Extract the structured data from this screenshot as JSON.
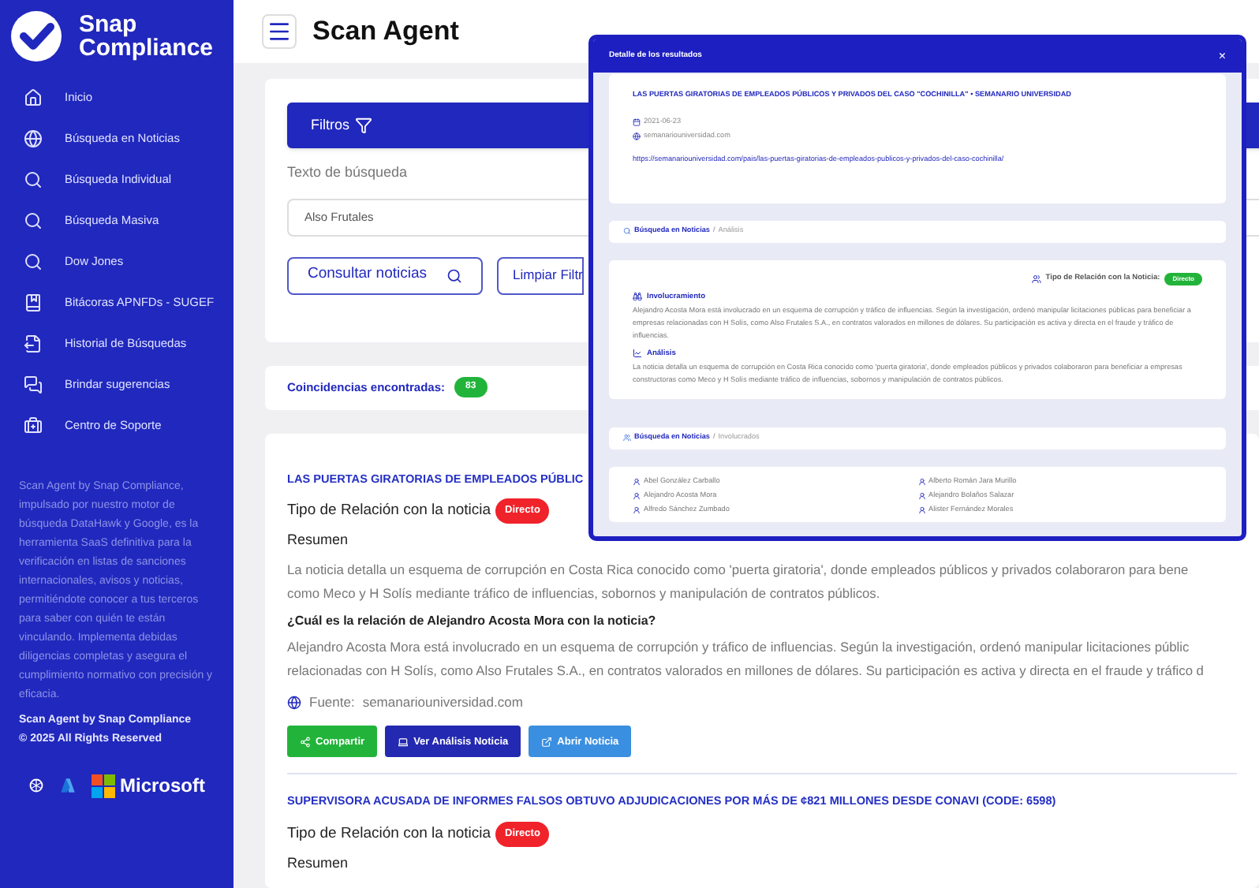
{
  "brand": [
    "Snap",
    "Compliance"
  ],
  "sidebar": {
    "items": [
      {
        "label": "Inicio",
        "kind": "home"
      },
      {
        "label": "Búsqueda en Noticias",
        "kind": "globe"
      },
      {
        "label": "Búsqueda Individual",
        "kind": "search"
      },
      {
        "label": "Búsqueda Masiva",
        "kind": "search"
      },
      {
        "label": "Dow Jones",
        "kind": "search"
      },
      {
        "label": "Bitácoras APNFDs - SUGEF",
        "kind": "book"
      },
      {
        "label": "Historial de Búsquedas",
        "kind": "export"
      },
      {
        "label": "Brindar sugerencias",
        "kind": "chat"
      },
      {
        "label": "Centro de Soporte",
        "kind": "kit"
      }
    ],
    "about": "Scan Agent by Snap Compliance, impulsado por nuestro motor de búsqueda DataHawk y Google, es la herramienta SaaS definitiva para la verificación en listas de sanciones internacionales, avisos y noticias, permitiéndote conocer a tus terceros para saber con quién te están vinculando. Implementa debidas diligencias completas y asegura el cumplimiento normativo con precisión y eficacia.",
    "footer": [
      "Scan Agent by Snap Compliance",
      "© 2025 All Rights Reserved"
    ],
    "partner_text": "Microsoft"
  },
  "header": {
    "title": "Scan Agent"
  },
  "filters": {
    "title": "Filtros",
    "search_label": "Texto de búsqueda",
    "search_value": "Also Frutales",
    "buttons": [
      "Consultar noticias",
      "Limpiar Filtr"
    ]
  },
  "matches": {
    "label": "Coincidencias encontradas:",
    "count": "83"
  },
  "results": [
    {
      "title": "LAS PUERTAS GIRATORIAS DE EMPLEADOS PÚBLIC",
      "relation_label": "Tipo de Relación con la noticia",
      "relation": "Directo",
      "summary_label": "Resumen",
      "summary_lines": [
        "La noticia detalla un esquema de corrupción en Costa Rica conocido como 'puerta giratoria', donde empleados públicos y privados colaboraron para bene",
        "como Meco y H Solís mediante tráfico de influencias, sobornos y manipulación de contratos públicos."
      ],
      "question": "¿Cuál es la relación de Alejandro Acosta Mora con la noticia?",
      "answer_lines": [
        "Alejandro Acosta Mora está involucrado en un esquema de corrupción y tráfico de influencias. Según la investigación, ordenó manipular licitaciones públic",
        "relacionadas con H Solís, como Also Frutales S.A., en contratos valorados en millones de dólares. Su participación es activa y directa en el fraude y tráfico d"
      ],
      "source_label": "Fuente:",
      "source": "semanariouniversidad.com",
      "actions": [
        {
          "label": "Compartir",
          "kind": "share"
        },
        {
          "label": "Ver Análisis Noticia",
          "kind": "analysis"
        },
        {
          "label": "Abrir Noticia",
          "kind": "open"
        }
      ]
    },
    {
      "title": "SUPERVISORA ACUSADA DE INFORMES FALSOS OBTUVO ADJUDICACIONES POR MÁS DE ¢821 MILLONES DESDE CONAVI (CODE: 6598)",
      "relation_label": "Tipo de Relación con la noticia",
      "relation": "Directo",
      "summary_label": "Resumen"
    }
  ],
  "modal": {
    "title": "Detalle de los resultados",
    "close": "×",
    "article": {
      "title": "LAS PUERTAS GIRATORIAS DE EMPLEADOS PÚBLICOS Y PRIVADOS DEL CASO \"COCHINILLA\" • SEMANARIO UNIVERSIDAD",
      "date": "2021-06-23",
      "site": "semanariouniversidad.com",
      "url": "https://semanariouniversidad.com/pais/las-puertas-giratorias-de-empleados-publicos-y-privados-del-caso-cochinilla/"
    },
    "breadcrumb_1": [
      "Búsqueda en Noticias",
      "/",
      "Análisis"
    ],
    "relation_label": "Tipo de Relación con la Noticia:",
    "relation": "Directo",
    "sections": [
      {
        "title": "Involucramiento",
        "kind": "binoculars",
        "text": "Alejandro Acosta Mora está involucrado en un esquema de corrupción y tráfico de influencias. Según la investigación, ordenó manipular licitaciones públicas para beneficiar a empresas relacionadas con H Solís, como Also Frutales S.A., en contratos valorados en millones de dólares. Su participación es activa y directa en el fraude y tráfico de influencias."
      },
      {
        "title": "Análisis",
        "kind": "chart",
        "text": "La noticia detalla un esquema de corrupción en Costa Rica conocido como 'puerta giratoria', donde empleados públicos y privados colaboraron para beneficiar a empresas constructoras como Meco y H Solís mediante tráfico de influencias, sobornos y manipulación de contratos públicos."
      }
    ],
    "breadcrumb_2": [
      "Búsqueda en Noticias",
      "/",
      "Involucrados"
    ],
    "people": [
      "Abel González Carballo",
      "Alberto Román Jara Murillo",
      "Alejandro Acosta Mora",
      "Alejandro Bolaños Salazar",
      "Alfredo Sánchez Zumbado",
      "Alister Fernández Morales"
    ]
  }
}
